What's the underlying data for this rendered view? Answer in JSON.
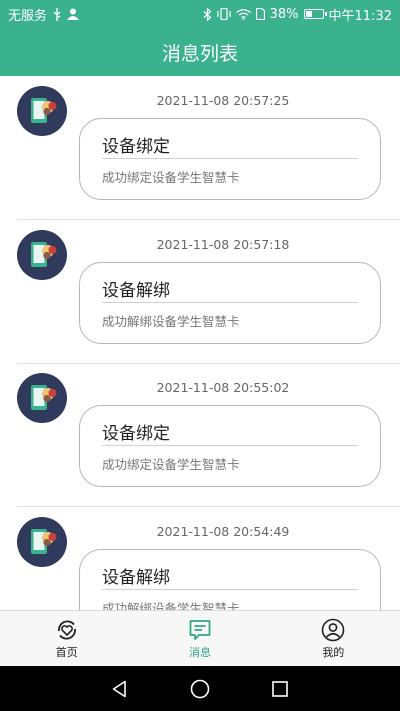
{
  "status_bar": {
    "carrier": "无服务",
    "battery_text": "38%",
    "battery_level": 0.38,
    "time": "中午11:32"
  },
  "header": {
    "title": "消息列表"
  },
  "messages": [
    {
      "time": "2021-11-08 20:57:25",
      "title": "设备绑定",
      "desc": "成功绑定设备学生智慧卡"
    },
    {
      "time": "2021-11-08 20:57:18",
      "title": "设备解绑",
      "desc": "成功解绑设备学生智慧卡"
    },
    {
      "time": "2021-11-08 20:55:02",
      "title": "设备绑定",
      "desc": "成功绑定设备学生智慧卡"
    },
    {
      "time": "2021-11-08 20:54:49",
      "title": "设备解绑",
      "desc": "成功解绑设备学生智慧卡"
    }
  ],
  "tabs": [
    {
      "label": "首页",
      "icon": "home-heart-icon"
    },
    {
      "label": "消息",
      "icon": "message-icon",
      "active": true
    },
    {
      "label": "我的",
      "icon": "user-icon"
    }
  ],
  "colors": {
    "accent": "#3bb28e",
    "active_tab": "#2fa487",
    "avatar_bg": "#2f3a5c"
  }
}
